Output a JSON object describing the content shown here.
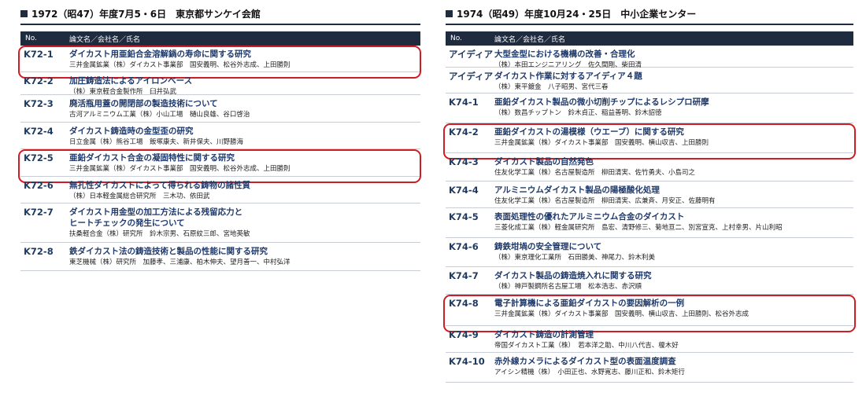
{
  "left": {
    "heading": "1972（昭47）年度7月5・6日　東京都サンケイ会館",
    "columns": {
      "no": "No.",
      "paper": "論文名／会社名／氏名"
    },
    "rows": [
      {
        "no": "K72-1",
        "title": [
          "ダイカスト用亜鉛合金溶解鍋の寿命に関する研究"
        ],
        "authors": "三井金属鉱業（株）ダイカスト事業部　国安義明、松谷外志成、上田勝則",
        "highlighted": true
      },
      {
        "no": "K72-2",
        "title": [
          "加圧鋳造法によるアイロンベース"
        ],
        "authors": "（株）東京軽合金製作所　臼井弘武",
        "highlighted": false
      },
      {
        "no": "K72-3",
        "title": [
          "廃活瓶用蓋の開閉部の製造技術について"
        ],
        "authors": "古河アルミニウム工業（株）小山工場　樋山良雄、谷口啓治",
        "highlighted": false
      },
      {
        "no": "K72-4",
        "title": [
          "ダイカスト鋳造時の金型歪の研究"
        ],
        "authors": "日立金属（株）熊谷工場　飯塚康夫、新井保夫、川野勝海",
        "highlighted": false
      },
      {
        "no": "K72-5",
        "title": [
          "亜鉛ダイカスト合金の凝固特性に関する研究"
        ],
        "authors": "三井金属鉱業（株）ダイカスト事業部　国安義明、松谷外志成、上田勝則",
        "highlighted": true
      },
      {
        "no": "K72-6",
        "title": [
          "無孔性ダイカストによって得られる鋳物の諸性質"
        ],
        "authors": "（株）日本軽金属総合研究所　三木功、依田武",
        "highlighted": false
      },
      {
        "no": "K72-7",
        "title": [
          "ダイカスト用金型の加工方法による残留応力と",
          "ヒートチェックの発生について"
        ],
        "authors": "扶桑軽合金（株）研究所　鈴木宗男、石原紋三郎、宮地英敏",
        "highlighted": false
      },
      {
        "no": "K72-8",
        "title": [
          "鉄ダイカスト法の鋳造技術と製品の性能に関する研究"
        ],
        "authors": "東芝機械（株）研究所　加藤孝、三浦康、柏木伸夫、望月善一、中村弘洋",
        "highlighted": false
      }
    ]
  },
  "right": {
    "heading": "1974（昭49）年度10月24・25日　中小企業センター",
    "columns": {
      "no": "No.",
      "paper": "論文名／会社名／氏名"
    },
    "rows": [
      {
        "no": "アイディア",
        "title": [
          "大型金型における機構の改善・合理化"
        ],
        "authors": "（株）本田エンジニアリング　佐久間剛、柴田清",
        "highlighted": false
      },
      {
        "no": "アイディア",
        "title": [
          "ダイカスト作業に対するアイディア４題"
        ],
        "authors": "（株）東平鍍金　八子昭男、宮代三春",
        "highlighted": false
      },
      {
        "no": "K74-1",
        "title": [
          "亜鉛ダイカスト製品の微小切削チップによるレシプロ研摩"
        ],
        "authors": "（株）数昌チップトン　鈴木貞正、稲益善明、鈴木詔徳",
        "highlighted": false
      },
      {
        "no": "K74-2",
        "title": [
          "亜鉛ダイカストの湯模様（ウエーブ）に関する研究"
        ],
        "authors": "三井金属鉱業（株）ダイカスト事業部　国安義明、横山収吉、上田勝則",
        "highlighted": true
      },
      {
        "no": "K74-3",
        "title": [
          "ダイカスト製品の自然発色"
        ],
        "authors": "住友化学工業（株）名古屋製造所　柳田清実、佐竹勇夫、小島司之",
        "highlighted": false
      },
      {
        "no": "K74-4",
        "title": [
          "アルミニウムダイカスト製品の陽極酸化処理"
        ],
        "authors": "住友化学工業（株）名古屋製造所　柳田清実、広兼斉、月安正、佐藤明有",
        "highlighted": false
      },
      {
        "no": "K74-5",
        "title": [
          "表面処理性の優れたアルミニウム合金のダイカスト"
        ],
        "authors": "三菱化成工業（株）軽金属研究所　島宏、清野修三、菊地亘二、別宮宣克、上村幸男、片山利昭",
        "highlighted": false
      },
      {
        "no": "K74-6",
        "title": [
          "鋳鉄坩堝の安全管理について"
        ],
        "authors": "（株）東京理化工業所　石田勝美、神尾力、鈴木利美",
        "highlighted": false
      },
      {
        "no": "K74-7",
        "title": [
          "ダイカスト製品の鋳造焼入れに関する研究"
        ],
        "authors": "（株）神戸製鋼所名古屋工場　松本浩志、赤沢順",
        "highlighted": false
      },
      {
        "no": "K74-8",
        "title": [
          "電子計算機による亜鉛ダイカストの要因解析の一例"
        ],
        "authors": "三井金属鉱業（株）ダイカスト事業部　国安義明、横山収吉、上田勝則、松谷外志成",
        "highlighted": true
      },
      {
        "no": "K74-9",
        "title": [
          "ダイカスト鋳造の計測管理"
        ],
        "authors": "帝国ダイカスト工業（株）　若本洋之助、中川八代吉、榎木好",
        "highlighted": false
      },
      {
        "no": "K74-10",
        "title": [
          "赤外線カメラによるダイカスト型の表面温度調査"
        ],
        "authors": "アイシン精機（株）　小田正也、水野寛志、藤川正和、鈴木矩行",
        "highlighted": false
      }
    ]
  }
}
